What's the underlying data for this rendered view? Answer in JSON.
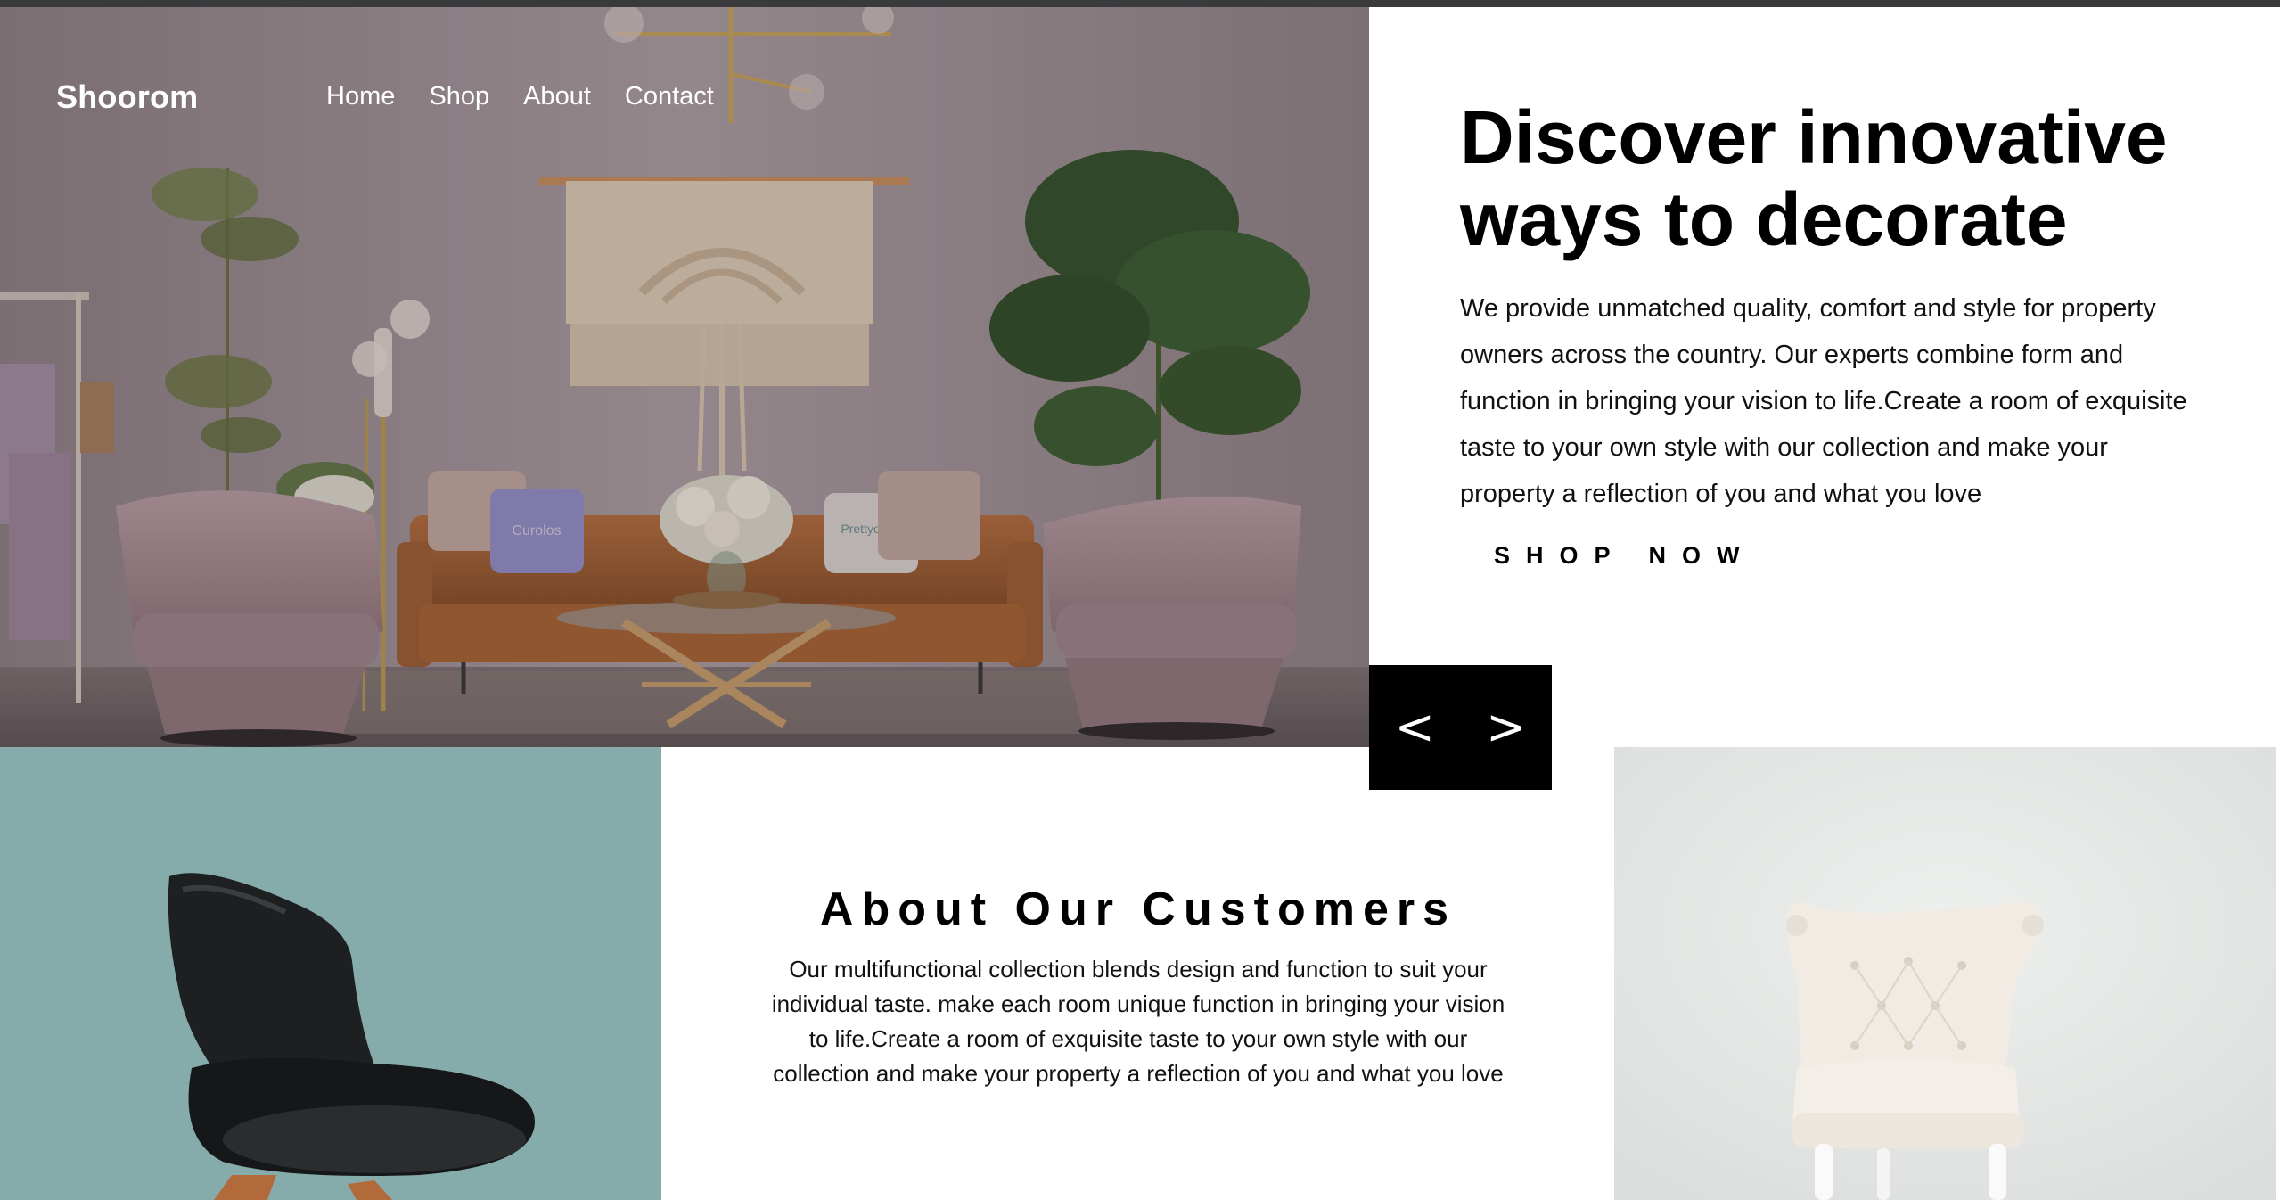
{
  "brand": {
    "name": "Shoorom"
  },
  "nav": {
    "items": [
      {
        "label": "Home"
      },
      {
        "label": "Shop"
      },
      {
        "label": "About"
      },
      {
        "label": "Contact"
      }
    ]
  },
  "hero": {
    "title": "Discover innovative ways to decorate",
    "description": "We provide unmatched quality, comfort and style for property owners across the country. Our experts combine form and function in bringing your vision to life.Create a room of exquisite taste to your own style with our collection and make your property a reflection of you and what you love",
    "cta_label": "SHOP NOW",
    "pillow_text_left": "Curolos",
    "pillow_text_right": "Prettyoskin"
  },
  "slider": {
    "prev_label": "<",
    "next_label": ">"
  },
  "about": {
    "title": "About Our Customers",
    "text": "Our multifunctional collection blends design and function to suit your individual taste. make each room unique function in bringing your vision to life.Create a room of exquisite taste to your own style with our collection and make your property a reflection of you and what you love"
  },
  "colors": {
    "hero_overlay": "#6e5e64",
    "teal_panel": "#86abab",
    "light_panel": "#e3e5e3",
    "sofa": "#a86436",
    "armchair": "#b3979c"
  }
}
